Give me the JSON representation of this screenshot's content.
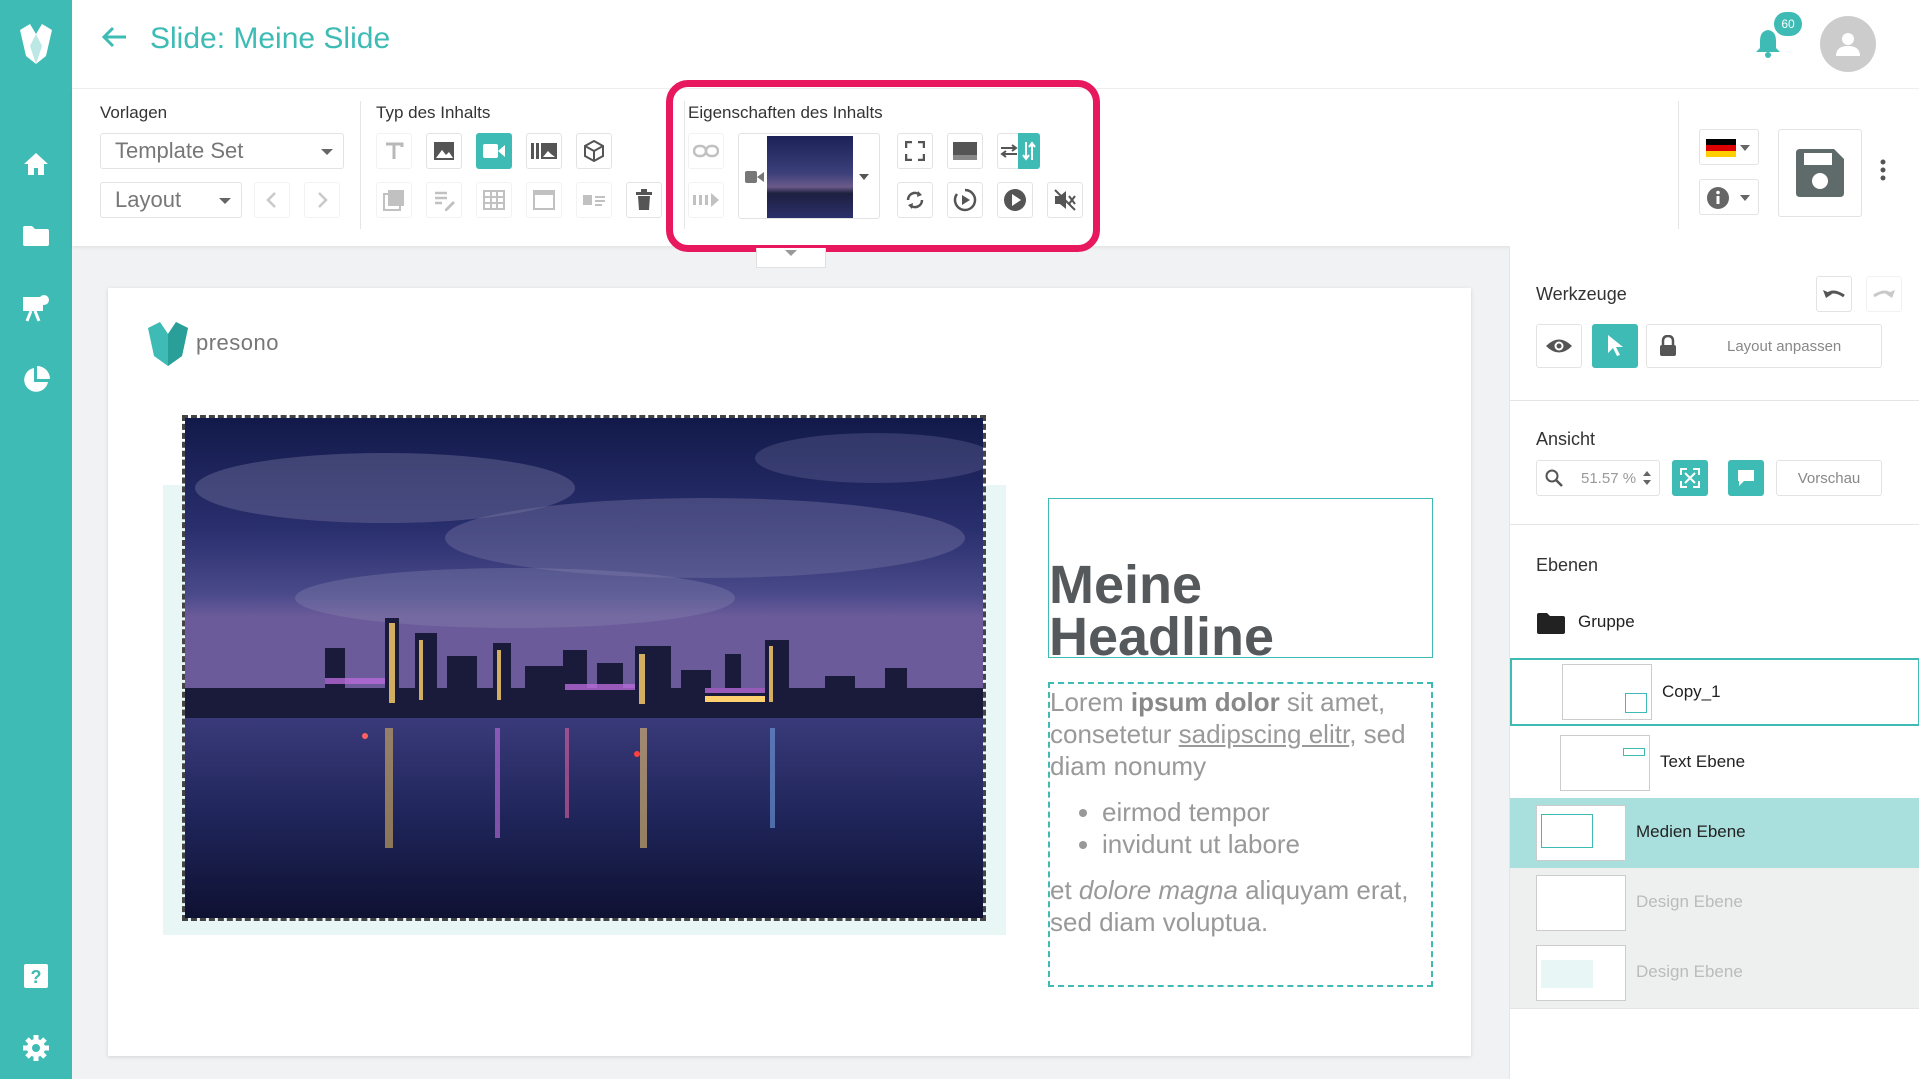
{
  "page": {
    "title": "Slide: Meine Slide"
  },
  "notifications": {
    "count": "60"
  },
  "toolbar": {
    "vorlagen_label": "Vorlagen",
    "template_set": "Template Set",
    "layout": "Layout",
    "typ_label": "Typ des Inhalts",
    "eigenschaften_label": "Eigenschaften des Inhalts"
  },
  "slide": {
    "logo_text": "presono",
    "headline_line1": "Meine",
    "headline_line2": "Headline",
    "body": {
      "p1_a": "Lorem ",
      "p1_b": "ipsum dolor",
      "p1_c": " sit amet, consetetur ",
      "p1_d": "sadipscing elitr",
      "p1_e": ", sed diam nonumy",
      "bullets": [
        "eirmod tempor",
        "invidunt ut labore"
      ],
      "p2_a": "et ",
      "p2_b": "dolore magna",
      "p2_c": " aliquyam erat, sed diam voluptua."
    }
  },
  "panel": {
    "werkzeuge": "Werkzeuge",
    "layout_anpassen": "Layout anpassen",
    "ansicht": "Ansicht",
    "zoom": "51.57 %",
    "vorschau": "Vorschau",
    "ebenen": "Ebenen",
    "layers": [
      {
        "name": "Gruppe"
      },
      {
        "name": "Copy_1"
      },
      {
        "name": "Text Ebene"
      },
      {
        "name": "Medien Ebene"
      },
      {
        "name": "Design Ebene"
      },
      {
        "name": "Design Ebene"
      }
    ]
  },
  "colors": {
    "accent": "#3dbbb4",
    "highlight": "#e8185f"
  }
}
